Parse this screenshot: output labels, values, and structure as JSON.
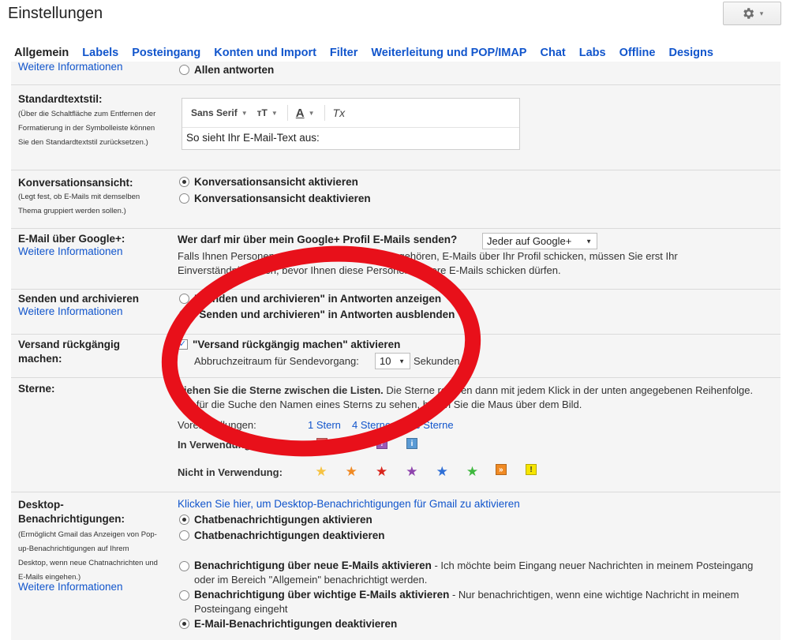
{
  "header": {
    "title": "Einstellungen",
    "gear_caret": "▾"
  },
  "tabs": [
    {
      "label": "Allgemein"
    },
    {
      "label": "Labels"
    },
    {
      "label": "Posteingang"
    },
    {
      "label": "Konten und Import"
    },
    {
      "label": "Filter"
    },
    {
      "label": "Weiterleitung und POP/IMAP"
    },
    {
      "label": "Chat"
    },
    {
      "label": "Labs"
    },
    {
      "label": "Offline"
    },
    {
      "label": "Designs"
    }
  ],
  "more_info": "Weitere Informationen",
  "reply": {
    "option": "Allen antworten"
  },
  "text_style": {
    "label": "Standardtextstil:",
    "help": "(Über die Schaltfläche zum Entfernen der Formatierung in der Symbolleiste können Sie den Standardtextstil zurücksetzen.)",
    "font": "Sans Serif",
    "size_icon": "тT",
    "color_icon": "A",
    "clear_icon": "Tx",
    "preview": "So sieht Ihr E-Mail-Text aus:"
  },
  "conversation": {
    "label": "Konversationsansicht:",
    "help": "(Legt fest, ob E-Mails mit demselben Thema gruppiert werden sollen.)",
    "on": "Konversationsansicht aktivieren",
    "off": "Konversationsansicht deaktivieren"
  },
  "google_plus": {
    "label": "E-Mail über Google+:",
    "question": "Wer darf mir über mein Google+ Profil E-Mails senden?",
    "select": "Jeder auf Google+",
    "note": "Falls Ihnen Personen, die nicht zu Ihren Kreisen gehören, E-Mails über Ihr Profil schicken, müssen Sie erst Ihr Einverständnis geben, bevor Ihnen diese Personen weitere E-Mails schicken dürfen."
  },
  "send_archive": {
    "label": "Senden und archivieren",
    "show": "\"Senden und archivieren\" in Antworten anzeigen",
    "hide": "\"Senden und archivieren\" in Antworten ausblenden"
  },
  "undo_send": {
    "label": "Versand rückgängig machen:",
    "enable": "\"Versand rückgängig machen\" aktivieren",
    "period_label": "Abbruchzeitraum für Sendevorgang:",
    "period_value": "10",
    "unit": "Sekunden"
  },
  "stars": {
    "label": "Sterne:",
    "intro_bold": "Ziehen Sie die Sterne zwischen die Listen.",
    "intro_rest": "Die Sterne rotieren dann mit jedem Klick in der unten angegebenen Reihenfolge. Um für die Suche den Namen eines Sterns zu sehen, halten Sie die Maus über dem Bild.",
    "presets_label": "Voreinstellungen:",
    "preset_1": "1 Stern",
    "preset_4": "4 Sterne",
    "preset_all": "Alle Sterne",
    "in_use": "In Verwendung:",
    "not_in_use": "Nicht in Verwendung:",
    "in_use_icons": [
      {
        "name": "red-bang-icon",
        "glyph": "!",
        "color": "#e06666"
      },
      {
        "name": "green-check-icon",
        "glyph": "✓",
        "color": "#3aa53a"
      },
      {
        "name": "purple-question-icon",
        "glyph": "?",
        "color": "#9b59b6"
      },
      {
        "name": "blue-info-icon",
        "glyph": "i",
        "color": "#5b9bd5"
      }
    ],
    "not_in_use_icons": [
      {
        "name": "yellow-star-icon",
        "glyph": "★",
        "color": "#f6c343"
      },
      {
        "name": "orange-star-icon",
        "glyph": "★",
        "color": "#f08a24"
      },
      {
        "name": "red-star-icon",
        "glyph": "★",
        "color": "#d9251d"
      },
      {
        "name": "purple-star-icon",
        "glyph": "★",
        "color": "#8e44ad"
      },
      {
        "name": "blue-star-icon",
        "glyph": "★",
        "color": "#2f6fd6"
      },
      {
        "name": "green-star-icon",
        "glyph": "★",
        "color": "#3fb83f"
      },
      {
        "name": "orange-guillemet-icon",
        "glyph": "»",
        "color": "#f08a24"
      },
      {
        "name": "yellow-bang-icon",
        "glyph": "!",
        "color": "#f6e500"
      }
    ]
  },
  "desktop": {
    "label": "Desktop-Benachrichtigungen:",
    "help": "(Ermöglicht Gmail das Anzeigen von Pop-up-Benachrichtigungen auf Ihrem Desktop, wenn neue Chatnachrichten und E-Mails eingehen.)",
    "enable_link": "Klicken Sie hier, um Desktop-Benachrichtigungen für Gmail zu aktivieren",
    "chat_on": "Chatbenachrichtigungen aktivieren",
    "chat_off": "Chatbenachrichtigungen deaktivieren",
    "new_mail_bold": "Benachrichtigung über neue E-Mails aktivieren",
    "new_mail_rest": " - Ich möchte beim Eingang neuer Nachrichten in meinem Posteingang oder im Bereich \"Allgemein\" benachrichtigt werden.",
    "important_bold": "Benachrichtigung über wichtige E-Mails aktivieren",
    "important_rest": " - Nur benachrichtigen, wenn eine wichtige Nachricht in meinem Posteingang eingeht",
    "off": "E-Mail-Benachrichtigungen deaktivieren"
  },
  "colors": {
    "link": "#1155cc",
    "annotation_red": "#e8101a"
  }
}
